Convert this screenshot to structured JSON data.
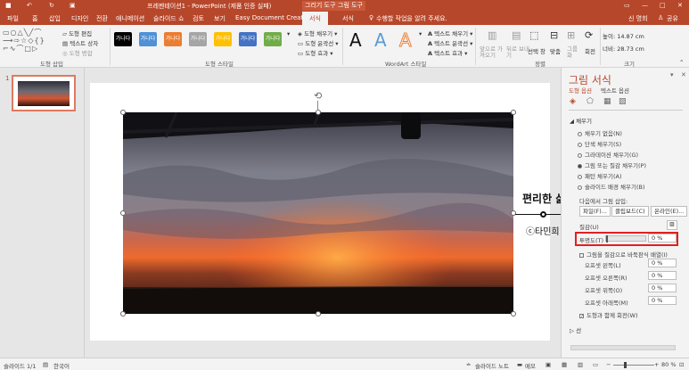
{
  "titlebar": {
    "title": "프레젠테이션1 - PowerPoint (제품 인증 실패)",
    "context1": "그리기 도구",
    "context2": "그림 도구"
  },
  "tabs": [
    "파일",
    "홈",
    "삽입",
    "디자인",
    "전환",
    "애니메이션",
    "슬라이드 쇼",
    "검토",
    "보기",
    "Easy Document Creator",
    "서식",
    "서식"
  ],
  "tell_me": "수행할 작업을 알려 주세요.",
  "user": "신 명희",
  "share": "공유",
  "ribbon": {
    "edit_shape": "도형 편집",
    "text_box": "텍스트 상자",
    "merge_shapes": "도형 병합",
    "group_insert": "도형 삽입",
    "swatch_text": "가나다",
    "group_styles": "도형 스타일",
    "fill": "도형 채우기",
    "outline": "도형 윤곽선",
    "effects": "도형 효과",
    "wordart_letter": "A",
    "text_fill": "텍스트 채우기",
    "text_outline": "텍스트 윤곽선",
    "text_effects": "텍스트 효과",
    "group_wordart": "WordArt 스타일",
    "bring_forward": "앞으로 가져오기",
    "send_backward": "뒤로 보내기",
    "select_pane": "선택 창",
    "align": "맞춤",
    "group": "그룹화",
    "rotate": "회전",
    "group_arrange": "정렬",
    "height": "높이: 14.87 cm",
    "width": "너비: 28.73 cm",
    "group_size": "크기"
  },
  "slide_number": "1",
  "overlay": {
    "title": "편리한 삶",
    "author": "ⓒ타민희"
  },
  "panel": {
    "title": "그림 서식",
    "tab1": "도형 옵션",
    "tab2": "텍스트 옵션",
    "section_fill": "채우기",
    "opt1": "채우기 없음(N)",
    "opt2": "단색 채우기(S)",
    "opt3": "그라데이션 채우기(G)",
    "opt4": "그림 또는 질감 채우기(P)",
    "opt5": "패턴 채우기(A)",
    "opt6": "슬라이드 배경 채우기(B)",
    "insert_from": "다음에서 그림 삽입:",
    "btn_file": "파일(F)...",
    "btn_clip": "클립보드(C)",
    "btn_online": "온라인(E)...",
    "texture": "질감(U)",
    "transparency_label": "투명도(T)",
    "transparency_value": "0 %",
    "tile": "그림을 질감으로 바둑판식 배열(I)",
    "offset_left": "오프셋 왼쪽(L)",
    "offset_right": "오프셋 오른쪽(R)",
    "offset_top": "오프셋 위쪽(O)",
    "offset_bottom": "오프셋 아래쪽(M)",
    "offset_value": "0 %",
    "rotate_with_shape": "도형과 함께 회전(W)",
    "section_line": "선"
  },
  "status": {
    "slide": "슬라이드 1/1",
    "lang": "한국어",
    "notes": "슬라이드 노트",
    "comments": "메모",
    "zoom": "80 %"
  },
  "colors": {
    "accent": "#b7472a",
    "highlight_box": "#e02020"
  }
}
